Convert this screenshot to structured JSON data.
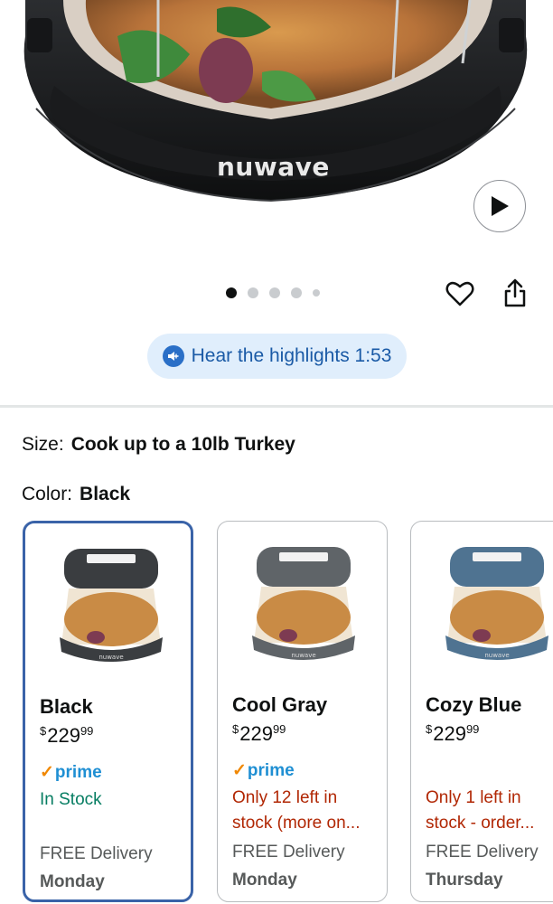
{
  "hero": {
    "brand": "nuwave"
  },
  "carousel": {
    "dot_count": 5,
    "active_index": 0
  },
  "audio": {
    "label": "Hear the highlights 1:53"
  },
  "size": {
    "label": "Size:",
    "value": "Cook up to a 10lb Turkey"
  },
  "color": {
    "label": "Color:",
    "value": "Black"
  },
  "variants": [
    {
      "name": "Black",
      "currency": "$",
      "price_whole": "229",
      "price_cents": "99",
      "prime": "prime",
      "availability_1": "In Stock",
      "availability_2": "",
      "delivery_label": "FREE Delivery",
      "delivery_day": "Monday",
      "body_color": "#3a3d40",
      "selected": true
    },
    {
      "name": "Cool Gray",
      "currency": "$",
      "price_whole": "229",
      "price_cents": "99",
      "prime": "prime",
      "availability_1": "Only 12 left in",
      "availability_2": "stock (more on...",
      "delivery_label": "FREE Delivery",
      "delivery_day": "Monday",
      "body_color": "#5f6468",
      "selected": false
    },
    {
      "name": "Cozy Blue",
      "currency": "$",
      "price_whole": "229",
      "price_cents": "99",
      "prime": "",
      "availability_1": "Only 1 left in",
      "availability_2": "stock - order...",
      "delivery_label": "FREE Delivery",
      "delivery_day": "Thursday",
      "body_color": "#4f7391",
      "selected": false
    }
  ]
}
